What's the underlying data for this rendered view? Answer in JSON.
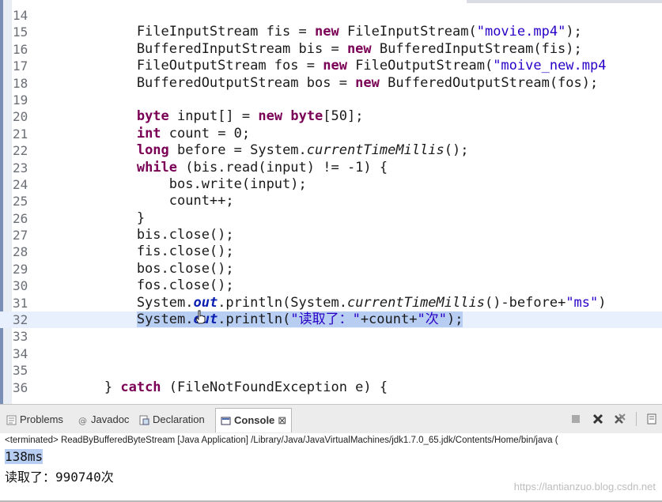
{
  "editor": {
    "lines": [
      {
        "num": "14",
        "parts": []
      },
      {
        "num": "15",
        "parts": [
          {
            "t": "            FileInputStream fis = "
          },
          {
            "t": "new",
            "c": "kw"
          },
          {
            "t": " FileInputStream("
          },
          {
            "t": "\"movie.mp4\"",
            "c": "str"
          },
          {
            "t": ");"
          }
        ]
      },
      {
        "num": "16",
        "parts": [
          {
            "t": "            BufferedInputStream bis = "
          },
          {
            "t": "new",
            "c": "kw"
          },
          {
            "t": " BufferedInputStream(fis);"
          }
        ]
      },
      {
        "num": "17",
        "parts": [
          {
            "t": "            FileOutputStream fos = "
          },
          {
            "t": "new",
            "c": "kw"
          },
          {
            "t": " FileOutputStream("
          },
          {
            "t": "\"moive_new.mp4",
            "c": "str"
          }
        ]
      },
      {
        "num": "18",
        "parts": [
          {
            "t": "            BufferedOutputStream bos = "
          },
          {
            "t": "new",
            "c": "kw"
          },
          {
            "t": " BufferedOutputStream(fos);"
          }
        ]
      },
      {
        "num": "19",
        "parts": []
      },
      {
        "num": "20",
        "parts": [
          {
            "t": "            "
          },
          {
            "t": "byte",
            "c": "kw"
          },
          {
            "t": " input[] = "
          },
          {
            "t": "new",
            "c": "kw"
          },
          {
            "t": " "
          },
          {
            "t": "byte",
            "c": "kw"
          },
          {
            "t": "[50];"
          }
        ]
      },
      {
        "num": "21",
        "parts": [
          {
            "t": "            "
          },
          {
            "t": "int",
            "c": "kw"
          },
          {
            "t": " count = 0;"
          }
        ]
      },
      {
        "num": "22",
        "parts": [
          {
            "t": "            "
          },
          {
            "t": "long",
            "c": "kw"
          },
          {
            "t": " before = System."
          },
          {
            "t": "currentTimeMillis",
            "c": "it"
          },
          {
            "t": "();"
          }
        ]
      },
      {
        "num": "23",
        "parts": [
          {
            "t": "            "
          },
          {
            "t": "while",
            "c": "kw"
          },
          {
            "t": " (bis.read(input) != -1) {"
          }
        ]
      },
      {
        "num": "24",
        "parts": [
          {
            "t": "                bos.write(input);"
          }
        ]
      },
      {
        "num": "25",
        "parts": [
          {
            "t": "                count++;"
          }
        ]
      },
      {
        "num": "26",
        "parts": [
          {
            "t": "            }"
          }
        ]
      },
      {
        "num": "27",
        "parts": [
          {
            "t": "            bis.close();"
          }
        ]
      },
      {
        "num": "28",
        "parts": [
          {
            "t": "            fis.close();"
          }
        ]
      },
      {
        "num": "29",
        "parts": [
          {
            "t": "            bos.close();"
          }
        ]
      },
      {
        "num": "30",
        "parts": [
          {
            "t": "            fos.close();"
          }
        ]
      },
      {
        "num": "31",
        "parts": [
          {
            "t": "            System."
          },
          {
            "t": "out",
            "c": "fld"
          },
          {
            "t": ".println(System."
          },
          {
            "t": "currentTimeMillis",
            "c": "it"
          },
          {
            "t": "()-before+"
          },
          {
            "t": "\"ms\"",
            "c": "str"
          },
          {
            "t": ")"
          }
        ]
      },
      {
        "num": "32",
        "highlight": true,
        "parts": [
          {
            "t": "            "
          },
          {
            "t": "System.",
            "c": "sel"
          },
          {
            "t": "out",
            "c": "fld sel"
          },
          {
            "t": ".println(",
            "c": "sel"
          },
          {
            "t": "\"读取了：\"",
            "c": "str sel"
          },
          {
            "t": "+count+",
            "c": "sel"
          },
          {
            "t": "\"次\"",
            "c": "str sel"
          },
          {
            "t": ");",
            "c": "sel"
          }
        ]
      },
      {
        "num": "33",
        "parts": []
      },
      {
        "num": "34",
        "parts": []
      },
      {
        "num": "35",
        "parts": []
      },
      {
        "num": "36",
        "parts": [
          {
            "t": "        } "
          },
          {
            "t": "catch",
            "c": "kw"
          },
          {
            "t": " (FileNotFoundException e) {"
          }
        ]
      }
    ]
  },
  "tabs": [
    {
      "label": "Problems",
      "icon": "problems-icon",
      "active": false
    },
    {
      "label": "Javadoc",
      "icon": "javadoc-icon",
      "active": false
    },
    {
      "label": "Declaration",
      "icon": "declaration-icon",
      "active": false
    },
    {
      "label": "Console",
      "icon": "console-icon",
      "active": true,
      "close": "⊠"
    }
  ],
  "toolbar_icons": [
    "terminate-icon",
    "remove-launch-icon",
    "remove-all-launches-icon",
    "scroll-lock-icon"
  ],
  "console": {
    "terminated": "<terminated> ReadByBufferedByteStream [Java Application] /Library/Java/JavaVirtualMachines/jdk1.7.0_65.jdk/Contents/Home/bin/java (",
    "output_line1": "138ms",
    "output_line2": "读取了：990740次"
  },
  "watermark": "https://lantianzuo.blog.csdn.net",
  "colors": {
    "keyword": "#7a0055",
    "string": "#2a00c8",
    "selection": "#b7cdf2",
    "highlight_line": "#e8f0fd"
  }
}
